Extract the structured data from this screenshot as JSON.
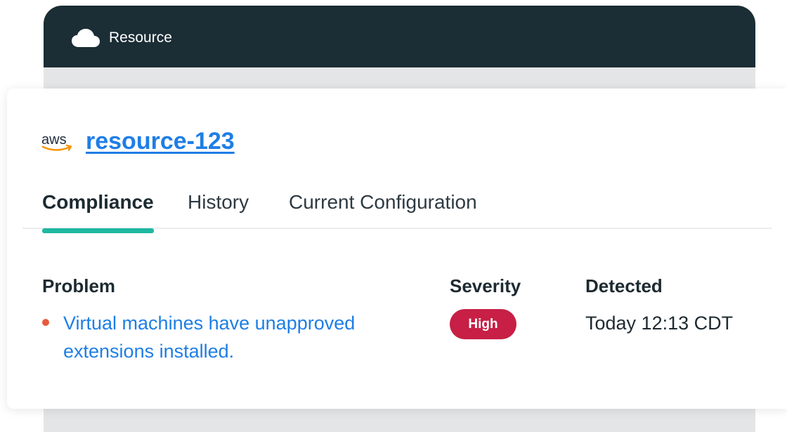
{
  "background_window": {
    "title": "Resource",
    "icon": "cloud-icon",
    "header_color": "#1b2d35"
  },
  "resource": {
    "provider_logo_text": "aws",
    "name": "resource-123"
  },
  "tabs": [
    {
      "label": "Compliance",
      "active": true
    },
    {
      "label": "History",
      "active": false
    },
    {
      "label": "Current Configuration",
      "active": false
    }
  ],
  "table": {
    "headers": {
      "problem": "Problem",
      "severity": "Severity",
      "detected": "Detected"
    },
    "rows": [
      {
        "problem": "Virtual machines have unapproved extensions installed.",
        "severity": "High",
        "detected": "Today 12:13 CDT"
      }
    ]
  },
  "colors": {
    "accent_teal": "#1fb8a1",
    "link_blue": "#1e7ee6",
    "severity_high": "#c71f45",
    "bullet_orange": "#e85a3c"
  }
}
